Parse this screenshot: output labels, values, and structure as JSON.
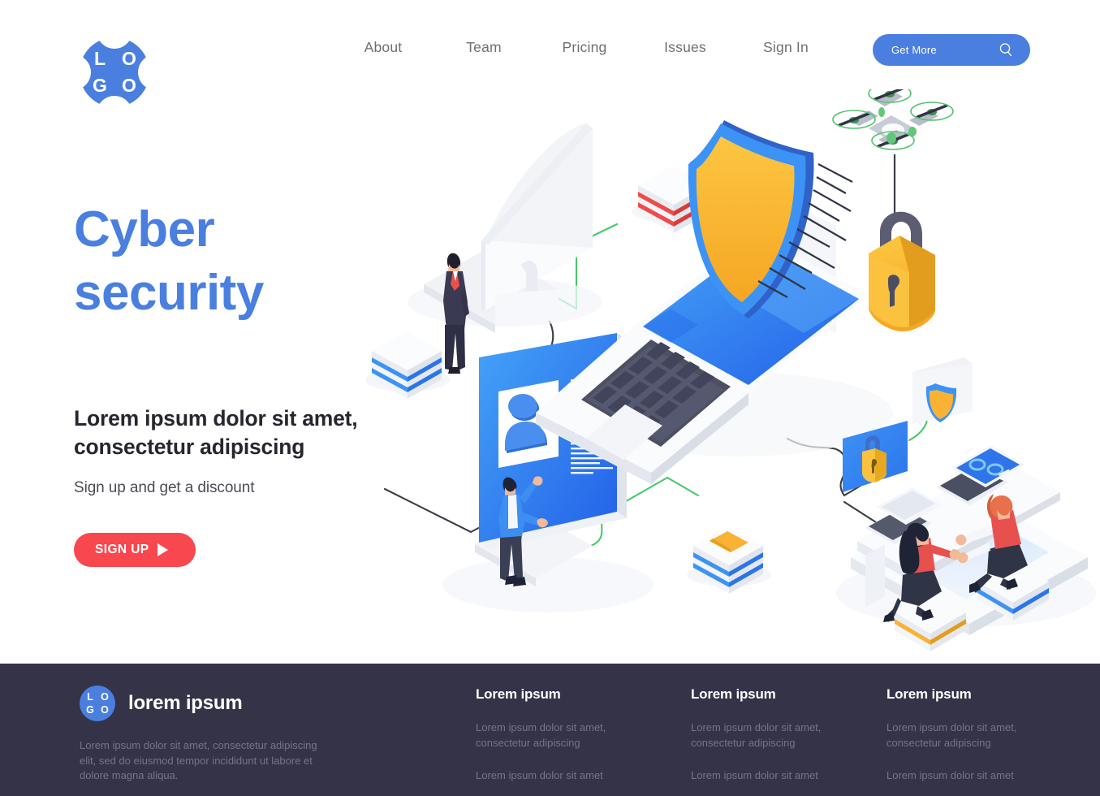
{
  "header": {
    "logo": {
      "letters": [
        "L",
        "O",
        "G",
        "O"
      ],
      "color": "#4a7fe0"
    },
    "nav": [
      {
        "label": "About"
      },
      {
        "label": "Team"
      },
      {
        "label": "Pricing"
      },
      {
        "label": "Issues"
      },
      {
        "label": "Sign In"
      }
    ],
    "cta": {
      "label": "Get More",
      "icon": "search-icon",
      "color": "#4a7fe0"
    }
  },
  "hero": {
    "title_line1": "Cyber",
    "title_line2": "security",
    "title_color": "#4a7fe0",
    "subtitle": "Lorem ipsum dolor sit amet, consectetur adipiscing",
    "tagline": "Sign up and get a discount",
    "button": {
      "label": "SIGN UP",
      "icon": "play-icon",
      "color": "#f8474f"
    }
  },
  "illustration": {
    "alt": "isometric cyber security scene",
    "elements": [
      "monitor-back",
      "businessman",
      "blue-screen-profile",
      "technician",
      "laptop",
      "shield",
      "padlock",
      "drone",
      "server-stack-blue",
      "server-stack-red",
      "server-stack-yellow",
      "shield-card",
      "lock-panel",
      "workstation-desk",
      "worker-female",
      "worker-male"
    ],
    "colors": {
      "accent_blue": "#2f80ed",
      "light_blue": "#4a9cf5",
      "shield_yellow": "#f9b233",
      "stripe_red": "#ef4b4b",
      "wire_green": "#4ec46a",
      "wire_dark": "#3c3c46"
    }
  },
  "footer": {
    "brand": {
      "logo_letters": [
        "L",
        "O",
        "G",
        "O"
      ],
      "name": "lorem ipsum"
    },
    "about": "Lorem ipsum dolor sit amet, consectetur adipiscing elit, sed do eiusmod tempor incididunt ut labore et dolore magna aliqua.",
    "columns": [
      {
        "title": "Lorem ipsum",
        "links": [
          "Lorem ipsum dolor sit amet, consectetur adipiscing",
          "Lorem ipsum dolor sit amet"
        ]
      },
      {
        "title": "Lorem ipsum",
        "links": [
          "Lorem ipsum dolor sit amet, consectetur adipiscing",
          "Lorem ipsum dolor sit amet"
        ]
      },
      {
        "title": "Lorem ipsum",
        "links": [
          "Lorem ipsum dolor sit amet, consectetur adipiscing",
          "Lorem ipsum dolor sit amet"
        ]
      }
    ],
    "background": "#343348"
  }
}
